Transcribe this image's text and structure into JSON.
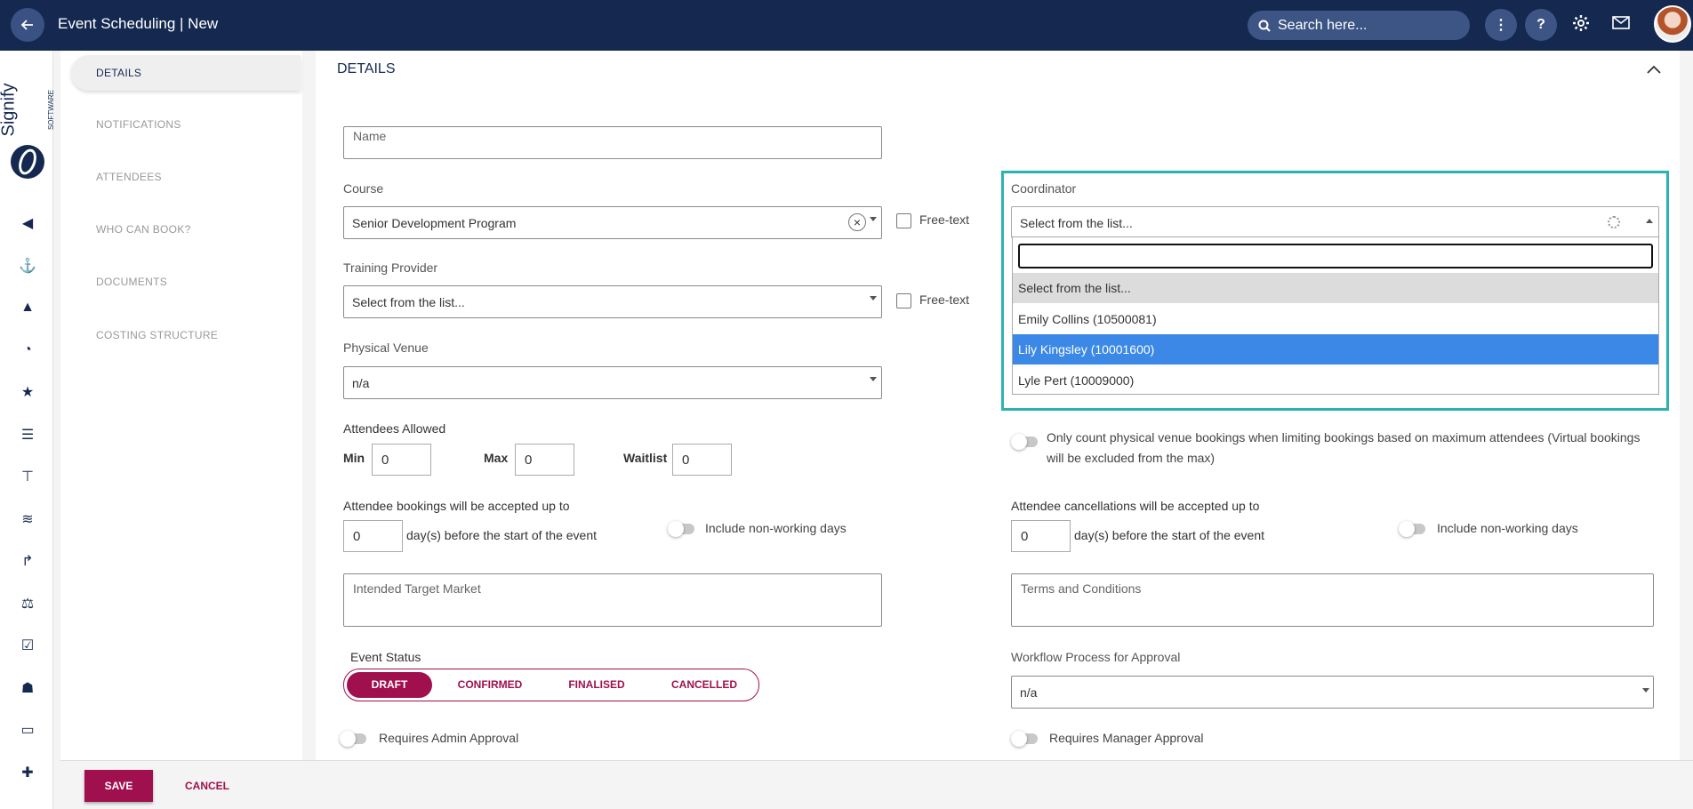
{
  "header": {
    "title": "Event Scheduling | New",
    "search_placeholder": "Search here..."
  },
  "logo": {
    "text": "Signify",
    "subtext": "SOFTWARE"
  },
  "sidenav": {
    "items": [
      {
        "label": "DETAILS"
      },
      {
        "label": "NOTIFICATIONS"
      },
      {
        "label": "ATTENDEES"
      },
      {
        "label": "WHO CAN BOOK?"
      },
      {
        "label": "DOCUMENTS"
      },
      {
        "label": "COSTING STRUCTURE"
      }
    ]
  },
  "details": {
    "section_title": "DETAILS",
    "name": {
      "placeholder": "Name",
      "value": ""
    },
    "course": {
      "label": "Course",
      "value": "Senior Development Program",
      "freetext_label": "Free-text"
    },
    "training_provider": {
      "label": "Training Provider",
      "value": "Select from the list...",
      "freetext_label": "Free-text"
    },
    "physical_venue": {
      "label": "Physical Venue",
      "value": "n/a"
    },
    "attendees_allowed": {
      "label": "Attendees Allowed",
      "min_label": "Min",
      "min_value": "0",
      "max_label": "Max",
      "max_value": "0",
      "waitlist_label": "Waitlist",
      "waitlist_value": "0"
    },
    "coordinator": {
      "label": "Coordinator",
      "value": "Select from the list...",
      "search_value": "",
      "options": [
        {
          "label": "Select from the list..."
        },
        {
          "label": "Emily Collins (10500081)"
        },
        {
          "label": "Lily Kingsley (10001600)"
        },
        {
          "label": "Lyle Pert (10009000)"
        }
      ]
    },
    "physical_count": {
      "line1": "Only count physical venue bookings when limiting bookings based on maximum attendees (Virtual bookings",
      "line2": "will be excluded from the max)"
    },
    "bookings_cutoff": {
      "label": "Attendee bookings will be accepted up to",
      "value": "0",
      "suffix": "day(s) before the start of the event",
      "toggle_label": "Include non-working days"
    },
    "cancellations_cutoff": {
      "label": "Attendee cancellations will be accepted up to",
      "value": "0",
      "suffix": "day(s) before the start of the event",
      "toggle_label": "Include non-working days"
    },
    "intended_target_market": {
      "placeholder": "Intended Target Market"
    },
    "terms_and_conditions": {
      "placeholder": "Terms and Conditions"
    },
    "event_status": {
      "label": "Event Status",
      "options": [
        "DRAFT",
        "CONFIRMED",
        "FINALISED",
        "CANCELLED"
      ],
      "selected": "DRAFT"
    },
    "workflow": {
      "label": "Workflow Process for Approval",
      "value": "n/a"
    },
    "requires_admin_approval": "Requires Admin Approval",
    "requires_manager_approval": "Requires Manager Approval"
  },
  "footer": {
    "save_label": "SAVE",
    "cancel_label": "CANCEL"
  },
  "colors": {
    "header_bg": "#142850",
    "accent": "#a0104e",
    "focus_frame": "#2bb3b0",
    "selected_option": "#3b88e6"
  }
}
